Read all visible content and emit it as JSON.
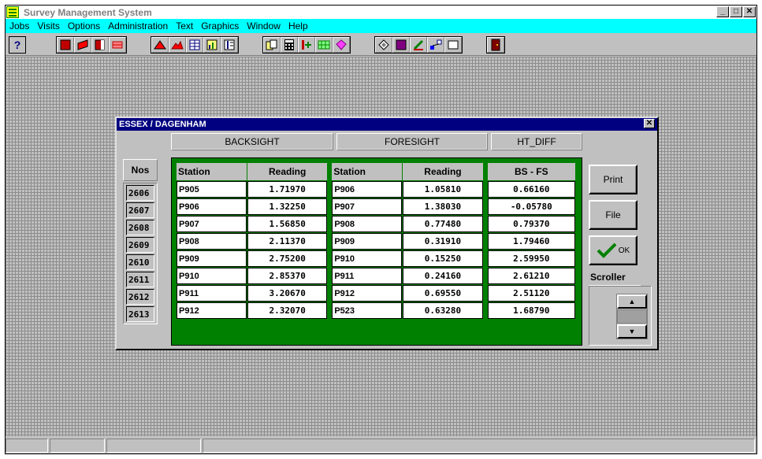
{
  "app": {
    "title": "Survey Management System",
    "controls": [
      "_",
      "□",
      "✕"
    ]
  },
  "menu": [
    {
      "label": "Jobs"
    },
    {
      "label": "Visits"
    },
    {
      "label": "Options"
    },
    {
      "label": "Administration"
    },
    {
      "label": "Text"
    },
    {
      "label": "Graphics"
    },
    {
      "label": "Window"
    },
    {
      "label": "Help"
    }
  ],
  "toolbar": {
    "help_glyph": "?",
    "groups": [
      [
        "red-square-icon",
        "red-flag-icon",
        "red-page-icon",
        "red-stack-icon"
      ],
      [
        "red-triangle-icon",
        "terrain-icon",
        "grid-table-icon",
        "chart-box-icon",
        "columns-icon"
      ],
      [
        "copy-icon",
        "calculator-icon",
        "axis-icon",
        "green-grid-icon",
        "pink-gem-icon"
      ],
      [
        "diamond-icon",
        "purple-square-icon",
        "pencil-icon",
        "network-icon",
        "blank-icon"
      ],
      [
        "exit-door-icon"
      ]
    ]
  },
  "dialog": {
    "title": "ESSEX / DAGENHAM",
    "close_glyph": "✕",
    "headers": {
      "backsight": "BACKSIGHT",
      "foresight": "FORESIGHT",
      "ht_diff": "HT_DIFF",
      "nos": "Nos"
    },
    "columns": {
      "station": "Station",
      "reading": "Reading",
      "station2": "Station",
      "reading2": "Reading",
      "bs_fs": "BS - FS"
    },
    "rows": [
      {
        "nos": "2606",
        "bs_station": "P905",
        "bs_reading": "1.71970",
        "fs_station": "P906",
        "fs_reading": "1.05810",
        "diff": "0.66160"
      },
      {
        "nos": "2607",
        "bs_station": "P906",
        "bs_reading": "1.32250",
        "fs_station": "P907",
        "fs_reading": "1.38030",
        "diff": "-0.05780"
      },
      {
        "nos": "2608",
        "bs_station": "P907",
        "bs_reading": "1.56850",
        "fs_station": "P908",
        "fs_reading": "0.77480",
        "diff": "0.79370"
      },
      {
        "nos": "2609",
        "bs_station": "P908",
        "bs_reading": "2.11370",
        "fs_station": "P909",
        "fs_reading": "0.31910",
        "diff": "1.79460"
      },
      {
        "nos": "2610",
        "bs_station": "P909",
        "bs_reading": "2.75200",
        "fs_station": "P910",
        "fs_reading": "0.15250",
        "diff": "2.59950"
      },
      {
        "nos": "2611",
        "bs_station": "P910",
        "bs_reading": "2.85370",
        "fs_station": "P911",
        "fs_reading": "0.24160",
        "diff": "2.61210"
      },
      {
        "nos": "2612",
        "bs_station": "P911",
        "bs_reading": "3.20670",
        "fs_station": "P912",
        "fs_reading": "0.69550",
        "diff": "2.51120"
      },
      {
        "nos": "2613",
        "bs_station": "P912",
        "bs_reading": "2.32070",
        "fs_station": "P523",
        "fs_reading": "0.63280",
        "diff": "1.68790"
      }
    ],
    "buttons": {
      "print": "Print",
      "file": "File",
      "ok": "OK"
    },
    "scroller": {
      "label": "Scroller",
      "up": "▲",
      "down": "▼"
    }
  }
}
